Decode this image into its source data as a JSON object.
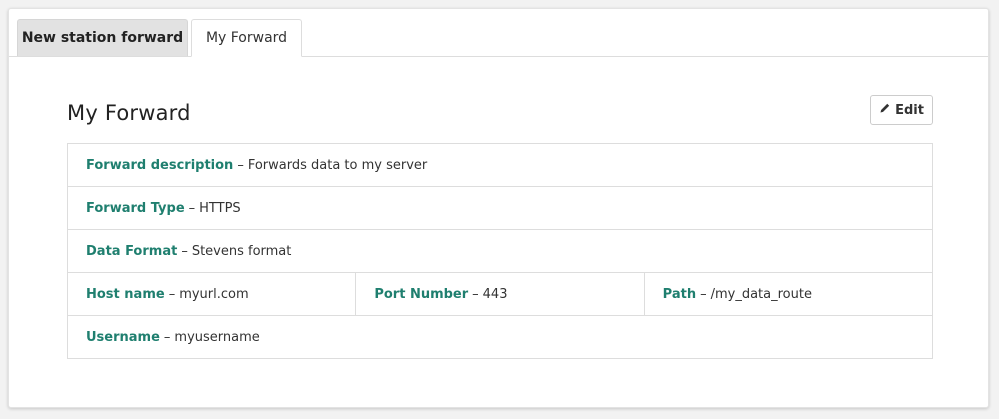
{
  "tabs": [
    {
      "label": "New station forward"
    },
    {
      "label": "My Forward"
    }
  ],
  "panel": {
    "title": "My Forward",
    "edit_label": "Edit"
  },
  "details": {
    "separator": "–",
    "description": {
      "label": "Forward description",
      "value": "Forwards data to my server"
    },
    "type": {
      "label": "Forward Type",
      "value": "HTTPS"
    },
    "format": {
      "label": "Data Format",
      "value": "Stevens format"
    },
    "host": {
      "label": "Host name",
      "value": "myurl.com"
    },
    "port": {
      "label": "Port Number",
      "value": "443"
    },
    "path": {
      "label": "Path",
      "value": "/my_data_route"
    },
    "username": {
      "label": "Username",
      "value": "myusername"
    }
  },
  "icons": {
    "edit": "pencil-icon"
  },
  "colors": {
    "label": "#1f7f6f",
    "tab_inactive_bg": "#e2e2e2"
  }
}
